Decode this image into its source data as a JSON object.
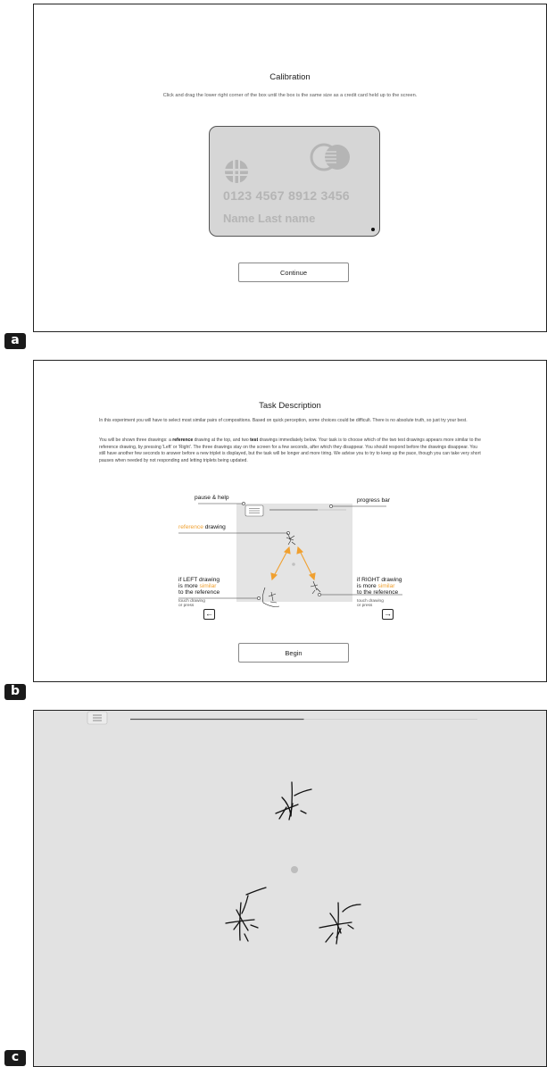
{
  "panels": {
    "a": {
      "label": "a",
      "title": "Calibration",
      "instruction": "Click and drag the lower right corner of the box until the box is the same size as a credit card held up to the screen.",
      "card": {
        "number": "0123  4567  8912  3456",
        "name": "Name  Last name"
      },
      "continue_label": "Continue"
    },
    "b": {
      "label": "b",
      "title": "Task Description",
      "paragraph1": "In this experiment you will have to select most similar pairs of compositions. Based on quick perception, some choices could be difficult. There is no absolute truth, so just try your best.",
      "p2_intro": "You will be shown three drawings: a ",
      "p2_bold1": "reference",
      "p2_mid1": " drawing at the top, and two ",
      "p2_bold2": "test",
      "p2_rest": " drawings immediately below. Your task is to choose which of the two test drawings appears more similar to the reference drawing, by pressing 'Left' or 'Right'. The three drawings stay on the screen for a few seconds, after which they disappear. You should respond before the drawings disappear. You still have another few seconds to answer before a new triplet is displayed, but the task will be longer and more tiring. We advise you to try to keep up the pace, though you can take very short pauses when needed by not responding and letting triplets being updated.",
      "diagram": {
        "pause_help": "pause & help",
        "progress_bar": "progress bar",
        "reference_word": "reference",
        "drawing_word": " drawing",
        "left_line1": "if LEFT drawing",
        "left_line2_a": "is more ",
        "left_line2_b": "similar",
        "left_line3": "to the reference",
        "right_line1": "if RIGHT drawing",
        "right_line2_a": "is more ",
        "right_line2_b": "similar",
        "right_line3": "to the reference",
        "touch_line1": "touch drawing",
        "touch_line2": "or press",
        "left_key": "←",
        "right_key": "→"
      },
      "begin_label": "Begin"
    },
    "c": {
      "label": "c",
      "progress": 0.5
    }
  },
  "colors": {
    "accent_orange": "#f0a030",
    "panel_c_bg": "#e2e2e2",
    "card_bg": "#d6d6d6"
  }
}
